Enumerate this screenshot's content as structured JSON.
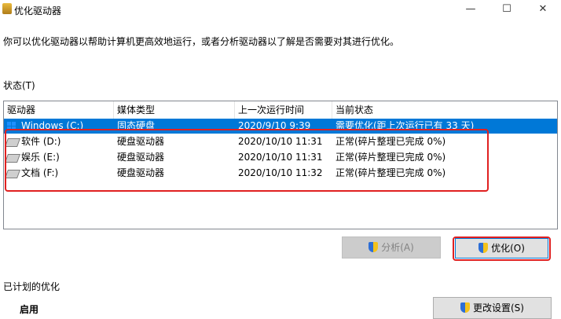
{
  "window": {
    "title": "优化驱动器",
    "minimize": "—",
    "maximize": "☐",
    "close": "✕"
  },
  "description": "你可以优化驱动器以帮助计算机更高效地运行，或者分析驱动器以了解是否需要对其进行优化。",
  "status_label": "状态(T)",
  "list": {
    "columns": [
      "驱动器",
      "媒体类型",
      "上一次运行时间",
      "当前状态"
    ],
    "rows": [
      {
        "drive": "Windows (C:)",
        "media": "固态硬盘",
        "last_run": "2020/9/10 9:39",
        "status": "需要优化(距上次运行已有 33 天)",
        "icon": "windows-drive-icon",
        "selected": true
      },
      {
        "drive": "软件 (D:)",
        "media": "硬盘驱动器",
        "last_run": "2020/10/10 11:31",
        "status": "正常(碎片整理已完成 0%)",
        "icon": "hard-drive-icon",
        "selected": false
      },
      {
        "drive": "娱乐 (E:)",
        "media": "硬盘驱动器",
        "last_run": "2020/10/10 11:31",
        "status": "正常(碎片整理已完成 0%)",
        "icon": "hard-drive-icon",
        "selected": false
      },
      {
        "drive": "文档 (F:)",
        "media": "硬盘驱动器",
        "last_run": "2020/10/10 11:32",
        "status": "正常(碎片整理已完成 0%)",
        "icon": "hard-drive-icon",
        "selected": false
      }
    ]
  },
  "buttons": {
    "analyze": "分析(A)",
    "optimize": "优化(O)",
    "change_settings": "更改设置(S)"
  },
  "scheduled_label": "已计划的优化",
  "scheduled_state": "启用",
  "colors": {
    "selection": "#0078d7",
    "highlight_box": "#e02020"
  }
}
